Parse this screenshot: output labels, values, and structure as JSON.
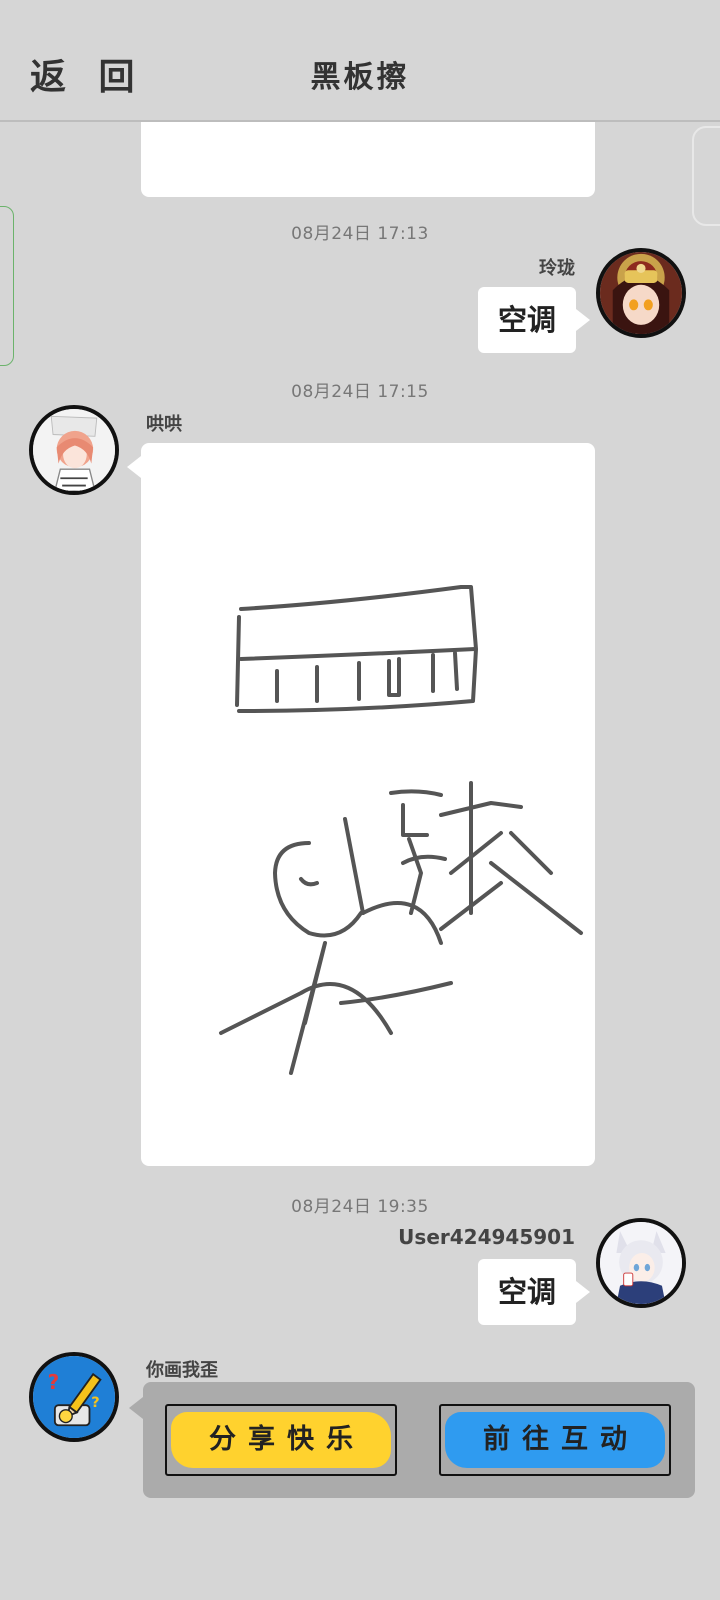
{
  "header": {
    "back_label": "返 回",
    "title": "黑板擦"
  },
  "messages": [
    {
      "time": "08月24日  17:13",
      "sender": "玲珑",
      "text": "空调",
      "side": "right"
    },
    {
      "time": "08月24日  17:15",
      "sender": "哄哄",
      "side": "left",
      "type": "drawing"
    },
    {
      "time": "08月24日  19:35",
      "sender": "User424945901",
      "text": "空调",
      "side": "right"
    },
    {
      "sender": "你画我歪",
      "side": "left",
      "type": "game-card"
    }
  ],
  "game_card": {
    "share_label": "分享快乐",
    "interact_label": "前往互动",
    "share_color": "#ffd22e",
    "interact_color": "#2f9bf0"
  },
  "icons": [
    "avatar-linglong",
    "avatar-honghong",
    "avatar-user",
    "pencil-question-icon"
  ]
}
